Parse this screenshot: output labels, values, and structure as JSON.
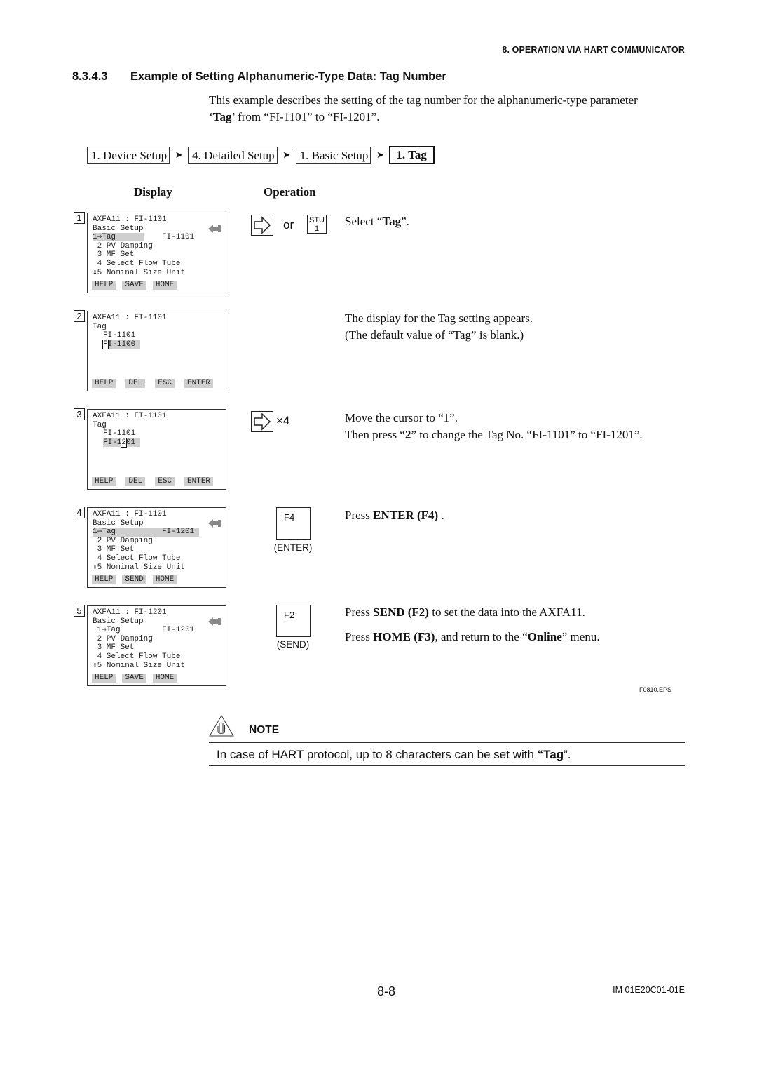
{
  "header": {
    "running_title": "8.  OPERATION VIA HART COMMUNICATOR",
    "section_number": "8.3.4.3",
    "section_title": "Example of Setting Alphanumeric-Type Data: Tag Number"
  },
  "intro": {
    "line1": "This example describes the setting of the tag number for the alphanumeric-type parameter",
    "line2_open": "‘",
    "line2_bold": "Tag",
    "line2_rest": "’ from “FI-1101” to “FI-1201”."
  },
  "breadcrumb": {
    "items": [
      "1. Device Setup",
      "4. Detailed Setup",
      "1. Basic Setup",
      "1.  Tag"
    ],
    "separator": "➤"
  },
  "columns": {
    "display": "Display",
    "operation": "Operation"
  },
  "steps": [
    {
      "number": "1",
      "lcd": {
        "title": "AXFA11 : FI-1101",
        "subtitle": "Basic Setup",
        "menu": [
          {
            "idx": "1⇒Tag",
            "value": "FI-1101",
            "highlight": true
          },
          {
            "idx": " 2 PV Damping"
          },
          {
            "idx": " 3 MF Set"
          },
          {
            "idx": " 4 Select Flow Tube"
          },
          {
            "idx": "⇓5 Nominal Size Unit"
          }
        ],
        "fkeys": [
          "HELP",
          "SAVE",
          "HOME"
        ],
        "return_icon": "return-arrow-icon"
      },
      "operation": {
        "key1_icon": "right-arrow-key-icon",
        "or": "or",
        "key2_top": "STU",
        "key2_bottom": "1",
        "text_pre": "Select “",
        "text_bold": "Tag",
        "text_post": "”."
      }
    },
    {
      "number": "2",
      "lcd": {
        "title": "AXFA11 : FI-1101",
        "subtitle": "Tag",
        "current_value": "FI-1101",
        "edit_cursor_char": "F",
        "edit_rest": "I-1100 ",
        "fkeys": [
          "HELP",
          "DEL",
          "ESC",
          "ENTER"
        ]
      },
      "operation": {
        "line1": "The display for the Tag setting appears.",
        "line2": "(The default value of “Tag” is blank.)"
      }
    },
    {
      "number": "3",
      "lcd": {
        "title": "AXFA11 : FI-1101",
        "subtitle": "Tag",
        "current_value": "FI-1101",
        "edit_before": "FI-1",
        "edit_cursor_char": "2",
        "edit_after": "01 ",
        "fkeys": [
          "HELP",
          "DEL",
          "ESC",
          "ENTER"
        ]
      },
      "operation": {
        "key_icon": "right-arrow-key-icon",
        "times": "×4",
        "line1": "Move the cursor to “1”.",
        "line2_pre": "Then press “",
        "line2_bold": "2",
        "line2_post": "” to change the Tag No. “FI-1101” to “FI-1201”."
      }
    },
    {
      "number": "4",
      "lcd": {
        "title": "AXFA11 : FI-1101",
        "subtitle": "Basic Setup",
        "menu": [
          {
            "idx": "1⇒Tag",
            "value": "FI-1201",
            "highlight": true
          },
          {
            "idx": " 2 PV Damping"
          },
          {
            "idx": " 3 MF Set"
          },
          {
            "idx": " 4 Select Flow Tube"
          },
          {
            "idx": "⇓5 Nominal Size Unit"
          }
        ],
        "fkeys": [
          "HELP",
          "SEND",
          "HOME"
        ],
        "return_icon": "return-arrow-icon"
      },
      "operation": {
        "key_label": "F4",
        "key_caption": "(ENTER)",
        "text_pre": "Press ",
        "text_bold": "ENTER (F4)",
        "text_post": " ."
      }
    },
    {
      "number": "5",
      "lcd": {
        "title": "AXFA11 : FI-1201",
        "subtitle": "Basic Setup",
        "menu": [
          {
            "idx": "1⇒Tag",
            "value": "FI-1201",
            "highlight": false
          },
          {
            "idx": " 2 PV Damping"
          },
          {
            "idx": " 3 MF Set"
          },
          {
            "idx": " 4 Select Flow Tube"
          },
          {
            "idx": "⇓5 Nominal Size Unit"
          }
        ],
        "fkeys": [
          "HELP",
          "SAVE",
          "HOME"
        ],
        "return_icon": "return-arrow-icon"
      },
      "operation": {
        "key_label": "F2",
        "key_caption": "(SEND)",
        "line1_pre": "Press ",
        "line1_bold": "SEND (F2)",
        "line1_post": " to set the data into the AXFA11.",
        "line2_pre": "Press ",
        "line2_bold": "HOME (F3)",
        "line2_mid": ", and return to the “",
        "line2_bold2": "Online",
        "line2_post": "” menu."
      }
    }
  ],
  "figure_id": "F0810.EPS",
  "note": {
    "icon": "caution-hand-icon",
    "label": "NOTE",
    "text_pre": "In case of HART protocol, up to 8 characters can be set with ",
    "text_bold": "“Tag",
    "text_post": "”."
  },
  "footer": {
    "page_number": "8-8",
    "document_id": "IM 01E20C01-01E"
  }
}
